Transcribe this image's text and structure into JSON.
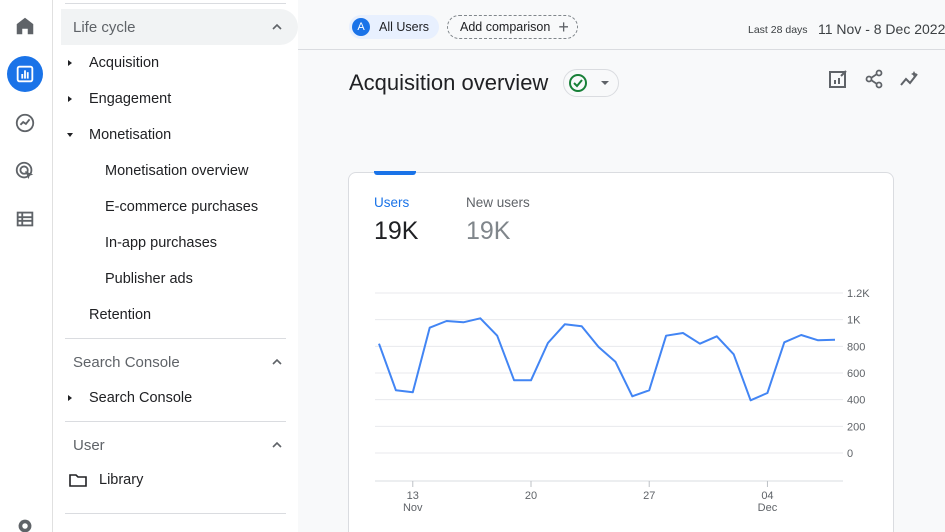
{
  "rail": {
    "icons": [
      "home-icon",
      "reports-icon",
      "explore-icon",
      "advertising-icon",
      "configure-icon",
      "settings-icon"
    ]
  },
  "nav": {
    "lifecycle": {
      "label": "Life cycle"
    },
    "items": [
      {
        "label": "Acquisition"
      },
      {
        "label": "Engagement"
      },
      {
        "label": "Monetisation"
      },
      {
        "label": "Retention"
      }
    ],
    "monetisation_sub": [
      {
        "label": "Monetisation overview"
      },
      {
        "label": "E-commerce purchases"
      },
      {
        "label": "In-app purchases"
      },
      {
        "label": "Publisher ads"
      }
    ],
    "search_console": {
      "label": "Search Console",
      "item": "Search Console"
    },
    "user": {
      "label": "User",
      "library": "Library"
    }
  },
  "topbar": {
    "segment_badge": "A",
    "segment_label": "All Users",
    "add_comparison": "Add comparison",
    "date_label": "Last 28 days",
    "date_range": "11 Nov - 8 Dec 2022"
  },
  "page": {
    "title": "Acquisition overview"
  },
  "card": {
    "metrics": [
      {
        "label": "Users",
        "value": "19K"
      },
      {
        "label": "New users",
        "value": "19K"
      }
    ]
  },
  "colors": {
    "accent": "#1a73e8",
    "line": "#4285f4"
  },
  "chart_data": {
    "type": "line",
    "ytick_labels": [
      "1.2K",
      "1K",
      "800",
      "600",
      "400",
      "200",
      "0"
    ],
    "yticks": [
      1200,
      1000,
      800,
      600,
      400,
      200,
      0
    ],
    "ylim": [
      0,
      1200
    ],
    "xtick_labels": [
      {
        "day": "13",
        "month": "Nov"
      },
      {
        "day": "20",
        "month": ""
      },
      {
        "day": "27",
        "month": ""
      },
      {
        "day": "04",
        "month": "Dec"
      }
    ],
    "xtick_index": [
      2,
      9,
      16,
      23
    ],
    "series": [
      {
        "values": [
          820,
          470,
          455,
          940,
          990,
          980,
          1010,
          880,
          545,
          545,
          825,
          965,
          950,
          795,
          685,
          425,
          470,
          880,
          900,
          820,
          875,
          740,
          395,
          450,
          830,
          885,
          845,
          850
        ]
      }
    ]
  }
}
